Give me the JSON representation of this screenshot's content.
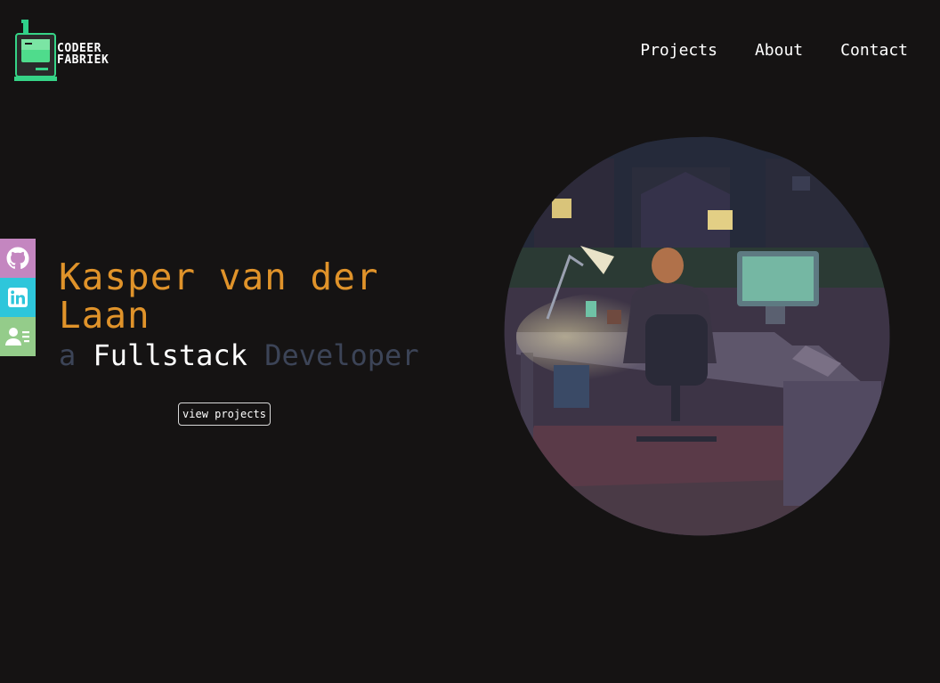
{
  "brand": {
    "line1": "CODEER",
    "line2": "FABRIEK",
    "logo_icon": "retro-computer-icon"
  },
  "nav": {
    "items": [
      {
        "label": "Projects"
      },
      {
        "label": "About"
      },
      {
        "label": "Contact"
      }
    ]
  },
  "social": {
    "items": [
      {
        "icon": "github-icon",
        "color": "#c486c0"
      },
      {
        "icon": "linkedin-icon",
        "color": "#2ec6db"
      },
      {
        "icon": "contact-card-icon",
        "color": "#94cc8a"
      }
    ]
  },
  "hero": {
    "name": "Kasper van der Laan",
    "sub_prefix": "a",
    "sub_main": "Fullstack",
    "sub_suffix": "Developer",
    "cta_label": "view projects"
  },
  "colors": {
    "background": "#151313",
    "accent": "#e0932a",
    "muted": "#3c4457"
  }
}
